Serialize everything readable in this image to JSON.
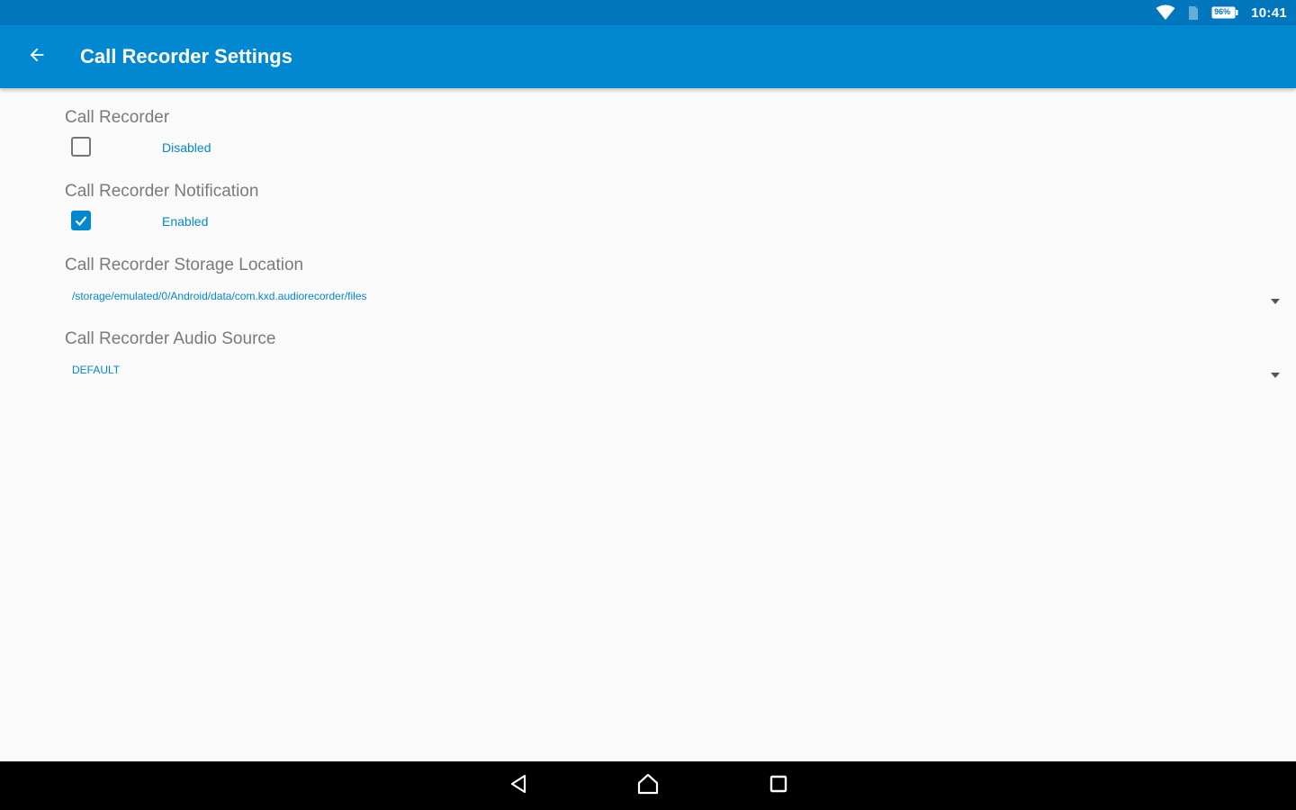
{
  "status_bar": {
    "time": "10:41",
    "battery_label": "96%",
    "icons": [
      "wifi-icon",
      "sim-icon",
      "battery-icon"
    ]
  },
  "toolbar": {
    "title": "Call Recorder Settings",
    "back_icon": "arrow-left-icon"
  },
  "settings": {
    "call_recorder": {
      "title": "Call Recorder",
      "state": "Disabled",
      "checked": false
    },
    "notification": {
      "title": "Call Recorder Notification",
      "state": "Enabled",
      "checked": true
    },
    "storage": {
      "title": "Call Recorder Storage Location",
      "value": "/storage/emulated/0/Android/data/com.kxd.audiorecorder/files"
    },
    "audio_source": {
      "title": "Call Recorder Audio Source",
      "value": "DEFAULT"
    }
  },
  "nav_bar": {
    "icons": [
      "back-triangle-icon",
      "home-icon",
      "recents-icon"
    ]
  },
  "colors": {
    "status_bar": "#0277bd",
    "toolbar": "#0288d1",
    "accent": "#0288d1",
    "background": "#fafafa"
  }
}
